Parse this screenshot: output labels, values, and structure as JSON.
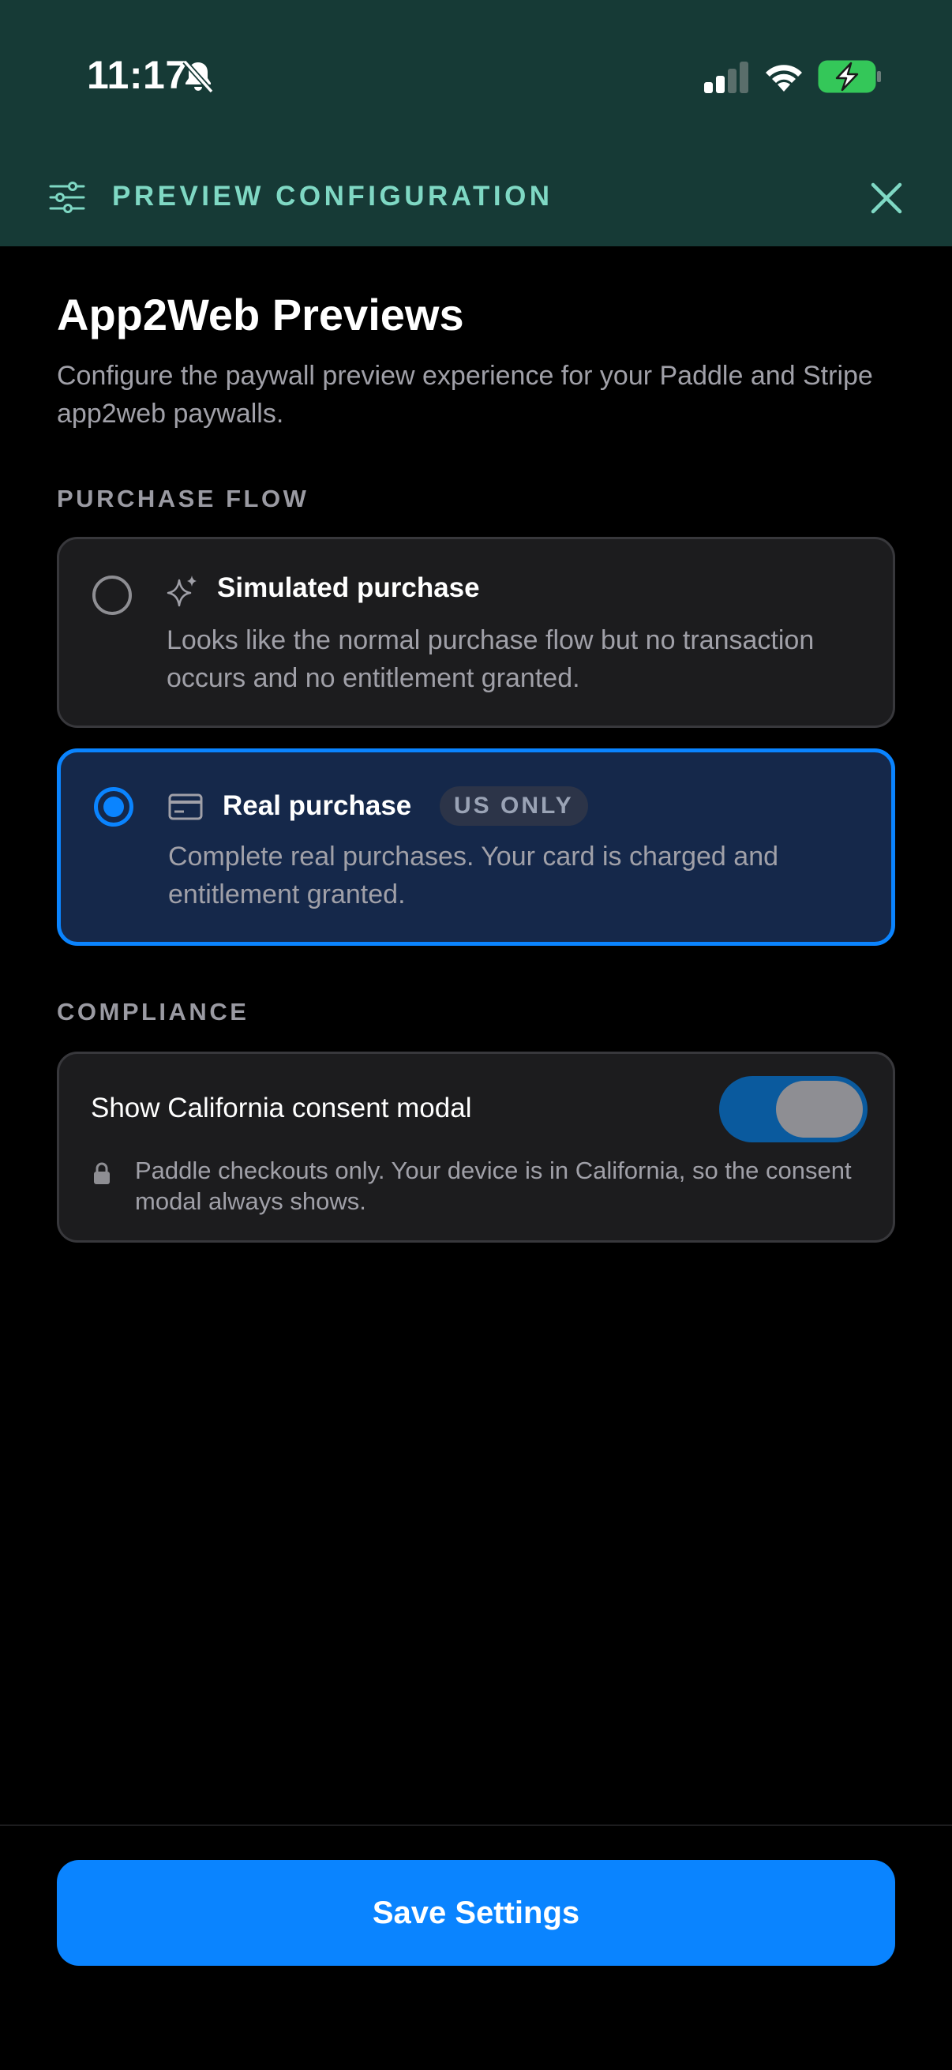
{
  "status_bar": {
    "time": "11:17",
    "icons": [
      "bell-off-icon",
      "cellular-signal-icon",
      "wifi-icon",
      "battery-charging-icon"
    ],
    "battery_color": "#34c759"
  },
  "header": {
    "title": "PREVIEW CONFIGURATION",
    "left_icon": "sliders-icon",
    "right_icon": "close-icon",
    "background_color": "#163a36",
    "accent_color": "#7fd8c4"
  },
  "page": {
    "title": "App2Web Previews",
    "subtitle": "Configure the paywall preview experience for your Paddle and Stripe app2web paywalls."
  },
  "purchase_flow": {
    "label": "PURCHASE FLOW",
    "options": [
      {
        "title": "Simulated purchase",
        "description": "Looks like the normal purchase flow but no transaction occurs and no entitlement granted.",
        "icon": "sparkles-icon",
        "selected": false
      },
      {
        "title": "Real purchase",
        "badge": "US ONLY",
        "description": "Complete real purchases. Your card is charged and entitlement granted.",
        "icon": "credit-card-icon",
        "selected": true
      }
    ]
  },
  "compliance": {
    "label": "COMPLIANCE",
    "toggle_label": "Show California consent modal",
    "toggle_on": true,
    "toggle_disabled": true,
    "note_icon": "lock-icon",
    "note": "Paddle checkouts only. Your device is in California, so the consent modal always shows."
  },
  "footer": {
    "save_label": "Save Settings",
    "accent_color": "#0a84ff"
  }
}
